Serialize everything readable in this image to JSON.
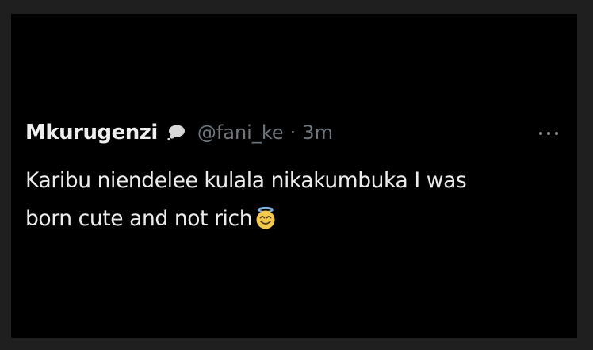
{
  "tweet": {
    "display_name": "Mkurugenzi",
    "badge_icon": "speech-bubble-icon",
    "handle": "@fani_ke",
    "separator": "·",
    "time": "3m",
    "more_icon": "more-options-icon",
    "text_line1": "Karibu niendelee kulala nikakumbuka I was",
    "text_line2": "born cute and not rich",
    "emoji": "smiling-face-with-halo",
    "colors": {
      "background": "#000000",
      "text": "#e9e9e9",
      "secondary_text": "#6e767d"
    }
  }
}
